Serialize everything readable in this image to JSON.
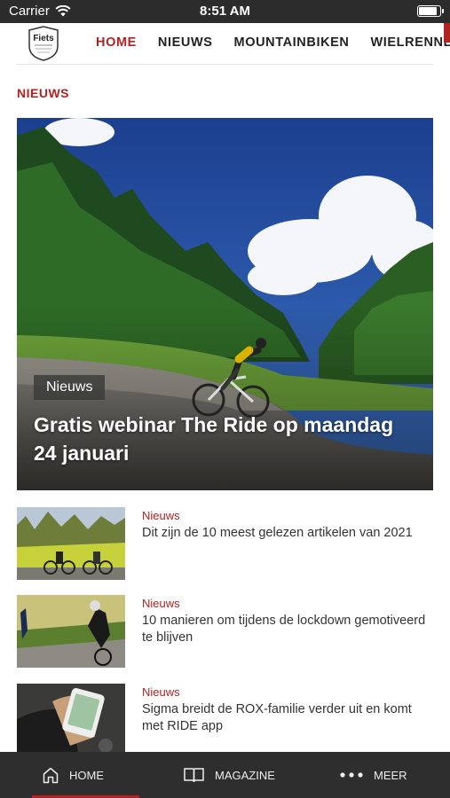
{
  "status_bar": {
    "carrier": "Carrier",
    "time": "8:51 AM",
    "battery_level": 0.9
  },
  "header": {
    "logo_text": "Fiets",
    "nav": [
      {
        "label": "HOME",
        "active": true
      },
      {
        "label": "NIEUWS",
        "active": false
      },
      {
        "label": "MOUNTAINBIKEN",
        "active": false
      },
      {
        "label": "WIELRENNEN",
        "active": false
      }
    ]
  },
  "section_title": "NIEUWS",
  "hero": {
    "category": "Nieuws",
    "title": "Gratis webinar The Ride op maandag 24 januari"
  },
  "articles": [
    {
      "category": "Nieuws",
      "title": "Dit zijn de 10 meest gelezen artikelen van 2021"
    },
    {
      "category": "Nieuws",
      "title": "10 manieren om tijdens de lockdown gemotiveerd te blijven"
    },
    {
      "category": "Nieuws",
      "title": "Sigma breidt de ROX-familie verder uit en komt met RIDE app"
    }
  ],
  "tabbar": [
    {
      "label": "HOME",
      "icon": "home-icon",
      "active": true
    },
    {
      "label": "MAGAZINE",
      "icon": "book-icon",
      "active": false
    },
    {
      "label": "MEER",
      "icon": "more-dots-icon",
      "active": false
    }
  ],
  "colors": {
    "accent": "#b22222",
    "tabbar": "#2e2e2e",
    "statusbar": "#2c2c2c"
  }
}
